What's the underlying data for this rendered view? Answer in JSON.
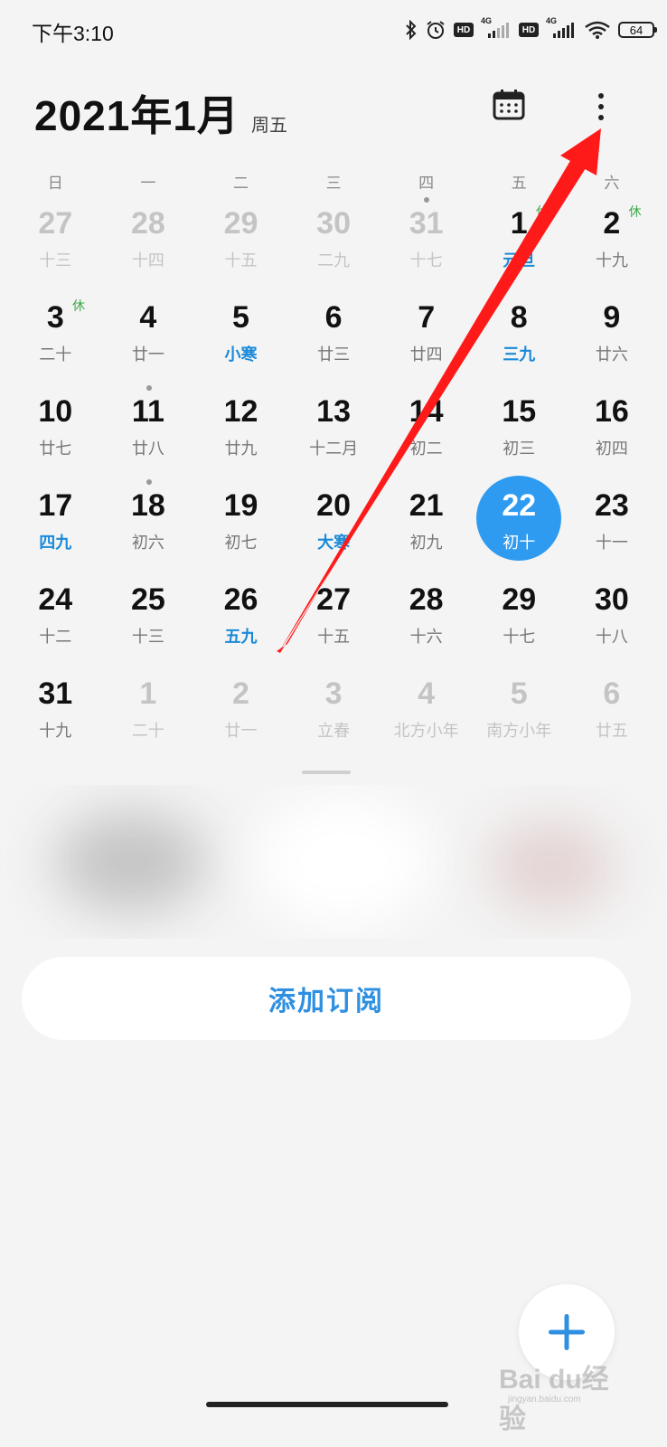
{
  "status_bar": {
    "time": "下午3:10",
    "network_label_1": "4G",
    "network_label_2": "4G",
    "hd_label": "HD",
    "battery": "64",
    "icons": [
      "bluetooth-icon",
      "alarm-icon",
      "hd-icon",
      "signal-icon",
      "hd-icon",
      "signal-icon",
      "wifi-icon",
      "battery-icon"
    ]
  },
  "header": {
    "title": "2021年1月",
    "weekday": "周五",
    "calendar_icon": "calendar-icon",
    "more_icon": "more-vertical-icon"
  },
  "weekdays": [
    "日",
    "一",
    "二",
    "三",
    "四",
    "五",
    "六"
  ],
  "weeks": [
    [
      {
        "day": "27",
        "sub": "十三",
        "muted": true
      },
      {
        "day": "28",
        "sub": "十四",
        "muted": true
      },
      {
        "day": "29",
        "sub": "十五",
        "muted": true
      },
      {
        "day": "30",
        "sub": "二九",
        "muted": true
      },
      {
        "day": "31",
        "sub": "十七",
        "muted": true,
        "dot": true
      },
      {
        "day": "1",
        "sub": "元旦",
        "blue": true,
        "tag": "休"
      },
      {
        "day": "2",
        "sub": "十九",
        "tag": "休"
      }
    ],
    [
      {
        "day": "3",
        "sub": "二十",
        "tag": "休"
      },
      {
        "day": "4",
        "sub": "廿一"
      },
      {
        "day": "5",
        "sub": "小寒",
        "blue": true
      },
      {
        "day": "6",
        "sub": "廿三"
      },
      {
        "day": "7",
        "sub": "廿四"
      },
      {
        "day": "8",
        "sub": "三九",
        "blue": true
      },
      {
        "day": "9",
        "sub": "廿六"
      }
    ],
    [
      {
        "day": "10",
        "sub": "廿七"
      },
      {
        "day": "11",
        "sub": "廿八",
        "dot": true
      },
      {
        "day": "12",
        "sub": "廿九"
      },
      {
        "day": "13",
        "sub": "十二月"
      },
      {
        "day": "14",
        "sub": "初二"
      },
      {
        "day": "15",
        "sub": "初三"
      },
      {
        "day": "16",
        "sub": "初四"
      }
    ],
    [
      {
        "day": "17",
        "sub": "四九",
        "blue": true
      },
      {
        "day": "18",
        "sub": "初六",
        "dot": true
      },
      {
        "day": "19",
        "sub": "初七"
      },
      {
        "day": "20",
        "sub": "大寒",
        "blue": true
      },
      {
        "day": "21",
        "sub": "初九"
      },
      {
        "day": "22",
        "sub": "初十",
        "today": true
      },
      {
        "day": "23",
        "sub": "十一"
      }
    ],
    [
      {
        "day": "24",
        "sub": "十二"
      },
      {
        "day": "25",
        "sub": "十三"
      },
      {
        "day": "26",
        "sub": "五九",
        "blue": true
      },
      {
        "day": "27",
        "sub": "十五"
      },
      {
        "day": "28",
        "sub": "十六"
      },
      {
        "day": "29",
        "sub": "十七"
      },
      {
        "day": "30",
        "sub": "十八"
      }
    ],
    [
      {
        "day": "31",
        "sub": "十九"
      },
      {
        "day": "1",
        "sub": "二十",
        "muted": true
      },
      {
        "day": "2",
        "sub": "廿一",
        "muted": true
      },
      {
        "day": "3",
        "sub": "立春",
        "muted": true
      },
      {
        "day": "4",
        "sub": "北方小年",
        "muted": true
      },
      {
        "day": "5",
        "sub": "南方小年",
        "muted": true
      },
      {
        "day": "6",
        "sub": "廿五",
        "muted": true
      }
    ]
  ],
  "subscribe": {
    "label": "添加订阅"
  },
  "fab": {
    "icon": "plus-icon"
  },
  "watermark": {
    "text": "Bai du经验",
    "sub": "jingyan.baidu.com"
  },
  "colors": {
    "accent": "#2f9bf0",
    "holiday_tag": "#3ea84a",
    "solar_term": "#1a8ad8",
    "annotation_arrow": "#ff1a1a"
  }
}
